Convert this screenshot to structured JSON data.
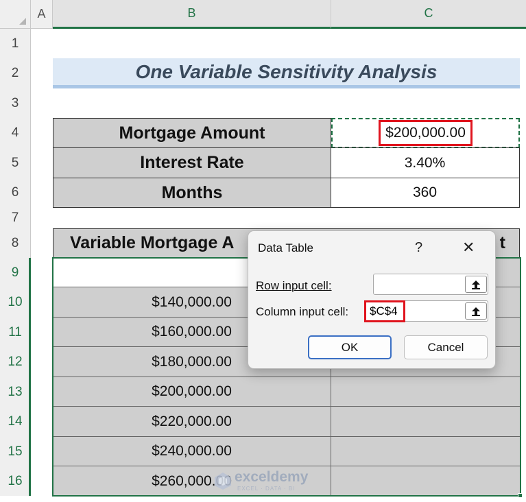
{
  "columns": [
    "A",
    "B",
    "C"
  ],
  "rows": [
    "1",
    "2",
    "3",
    "4",
    "5",
    "6",
    "7",
    "8",
    "9",
    "10",
    "11",
    "12",
    "13",
    "14",
    "15",
    "16"
  ],
  "title": "One Variable Sensitivity Analysis",
  "inputs": [
    {
      "label": "Mortgage Amount",
      "value": "$200,000.00"
    },
    {
      "label": "Interest Rate",
      "value": "3.40%"
    },
    {
      "label": "Months",
      "value": "360"
    }
  ],
  "table": {
    "header_left": "Variable Mortgage A",
    "header_right": "t",
    "amounts": [
      "$140,000.00",
      "$160,000.00",
      "$180,000.00",
      "$200,000.00",
      "$220,000.00",
      "$240,000.00",
      "$260,000.00"
    ]
  },
  "dialog": {
    "title": "Data Table",
    "help": "?",
    "close": "✕",
    "row_label": "Row input cell:",
    "row_value": "",
    "col_label": "Column input cell:",
    "col_value": "$C$4",
    "ok": "OK",
    "cancel": "Cancel"
  },
  "watermark": {
    "name": "exceldemy",
    "tagline": "EXCEL · DATA · BI"
  },
  "colors": {
    "accent": "#217346",
    "highlight": "#e0141e",
    "title_fill": "#dde9f6",
    "title_text": "#3a4a5c",
    "cell_gray": "#cfcfcf"
  }
}
